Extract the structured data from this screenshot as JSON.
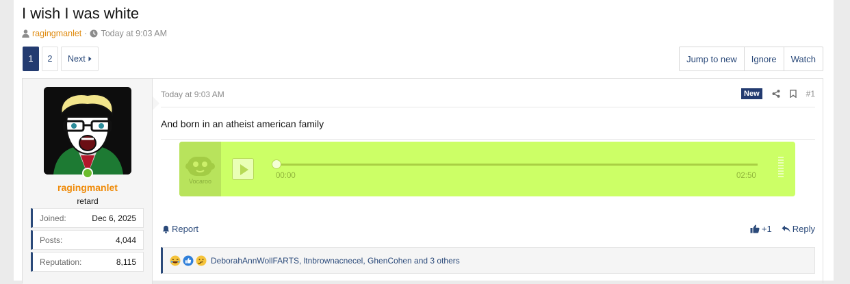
{
  "thread": {
    "title": "I wish I was white",
    "author": "ragingmanlet",
    "separator": "·",
    "time": "Today at 9:03 AM"
  },
  "pagination": {
    "pages": [
      "1",
      "2"
    ],
    "next_label": "Next"
  },
  "thread_actions": {
    "jump": "Jump to new",
    "ignore": "Ignore",
    "watch": "Watch"
  },
  "user": {
    "name": "ragingmanlet",
    "title": "retard",
    "stats": [
      {
        "key": "Joined:",
        "value": "Dec 6, 2025"
      },
      {
        "key": "Posts:",
        "value": "4,044"
      },
      {
        "key": "Reputation:",
        "value": "8,115"
      }
    ]
  },
  "post": {
    "time": "Today at 9:03 AM",
    "new_badge": "New",
    "number": "#1",
    "body": "And born in an atheist american family"
  },
  "vocaroo": {
    "brand": "Vocaroo",
    "current": "00:00",
    "duration": "02:50",
    "progress": 0
  },
  "post_footer": {
    "report": "Report",
    "like_count": "+1",
    "reply": "Reply"
  },
  "reactions": {
    "text": "DeborahAnnWollFARTS, ltnbrownacnecel, GhenCohen and 3 others"
  },
  "colors": {
    "accent": "#233b70",
    "username": "#ef8a08",
    "vocaroo_bg": "#ccff66",
    "online": "#6bbd2d"
  }
}
